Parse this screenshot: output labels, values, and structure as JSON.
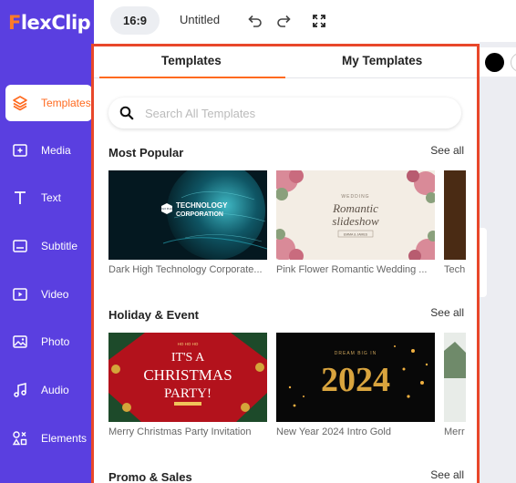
{
  "app": {
    "logo_f": "F",
    "logo_rest": "lexClip"
  },
  "sidebar": {
    "items": [
      {
        "label": "Templates",
        "icon": "layers-icon"
      },
      {
        "label": "Media",
        "icon": "media-add-icon"
      },
      {
        "label": "Text",
        "icon": "text-icon"
      },
      {
        "label": "Subtitle",
        "icon": "subtitle-icon"
      },
      {
        "label": "Video",
        "icon": "video-icon"
      },
      {
        "label": "Photo",
        "icon": "photo-icon"
      },
      {
        "label": "Audio",
        "icon": "audio-icon"
      },
      {
        "label": "Elements",
        "icon": "elements-icon"
      }
    ]
  },
  "topbar": {
    "ratio": "16:9",
    "title": "Untitled"
  },
  "panel": {
    "tabs": [
      "Templates",
      "My Templates"
    ],
    "search_placeholder": "Search All Templates",
    "sections": [
      {
        "title": "Most Popular",
        "see_all": "See all",
        "items": [
          {
            "caption": "Dark High Technology Corporate...",
            "overlay_badge": "LOGO PLACE",
            "overlay_line1": "TECHNOLOGY",
            "overlay_line2": "CORPORATION"
          },
          {
            "caption": "Pink Flower Romantic Wedding ...",
            "overlay_small": "WEDDING",
            "overlay_line1": "Romantic",
            "overlay_line2": "slideshow",
            "overlay_names": "EMMA & JAMES"
          },
          {
            "caption": "Tech"
          }
        ]
      },
      {
        "title": "Holiday & Event",
        "see_all": "See all",
        "items": [
          {
            "caption": "Merry Christmas Party Invitation",
            "overlay_small": "HO HO HO",
            "overlay_line1": "IT'S A",
            "overlay_line2": "CHRISTMAS",
            "overlay_line3": "PARTY!"
          },
          {
            "caption": "New Year 2024 Intro Gold",
            "overlay_small": "DREAM BIG IN",
            "overlay_line1": "2024"
          },
          {
            "caption": "Merr"
          }
        ]
      },
      {
        "title": "Promo & Sales",
        "see_all": "See all"
      }
    ]
  },
  "colors": {
    "sidebar": "#5a3fe0",
    "accent": "#ff6a1f",
    "highlight": "#e8472a"
  }
}
